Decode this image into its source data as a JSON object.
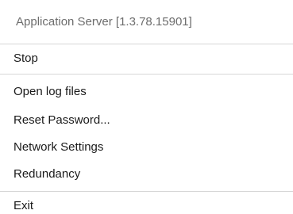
{
  "menu": {
    "header": "Application Server [1.3.78.15901]",
    "stop": "Stop",
    "open_log_files": "Open log files",
    "reset_password": "Reset Password...",
    "network_settings": "Network Settings",
    "redundancy": "Redundancy",
    "exit": "Exit"
  }
}
